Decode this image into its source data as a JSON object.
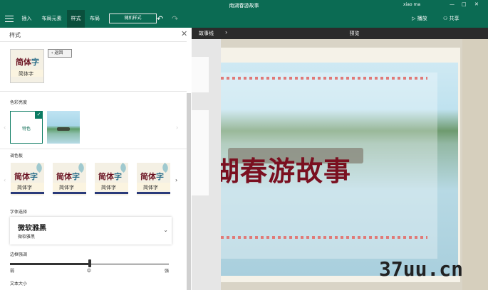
{
  "window": {
    "title": "南湖春游故事",
    "user": "xiao ma",
    "controls": [
      "—",
      "□",
      "✕"
    ]
  },
  "ribbon": {
    "tabs": [
      "插入",
      "布局元素",
      "样式",
      "布局"
    ],
    "random_style": "随机样式",
    "play": "播放",
    "share": "共享"
  },
  "style_panel": {
    "title": "样式",
    "back_label": "返回",
    "theme_thumb": {
      "big": "简体",
      "big_accent": "字",
      "small": "简体字"
    },
    "color_theme_label": "色彩亮度",
    "custom_tile_label": "特色",
    "palette_label": "调色板",
    "palettes": [
      {
        "big": "简体",
        "accent": "字",
        "small": "简体字"
      },
      {
        "big": "简体",
        "accent": "字",
        "small": "简体字"
      },
      {
        "big": "简体",
        "accent": "字",
        "small": "简体字"
      },
      {
        "big": "简体",
        "accent": "字",
        "small": "简体字"
      }
    ],
    "font_label": "字体选择",
    "font_name": "微软雅黑",
    "font_sub": "微软雅黑",
    "intensity_label": "边框强调",
    "intensity_ticks": [
      "弱",
      "中",
      "强"
    ],
    "intensity_value": 0.5,
    "text_size_label": "文本大小"
  },
  "storyline": {
    "tab_label": "故事线"
  },
  "preview": {
    "header": "预览",
    "title_text": "湖春游故事"
  },
  "watermark": "37uu.cn",
  "colors": {
    "accent": "#0b6b53",
    "title": "#7a1020"
  }
}
